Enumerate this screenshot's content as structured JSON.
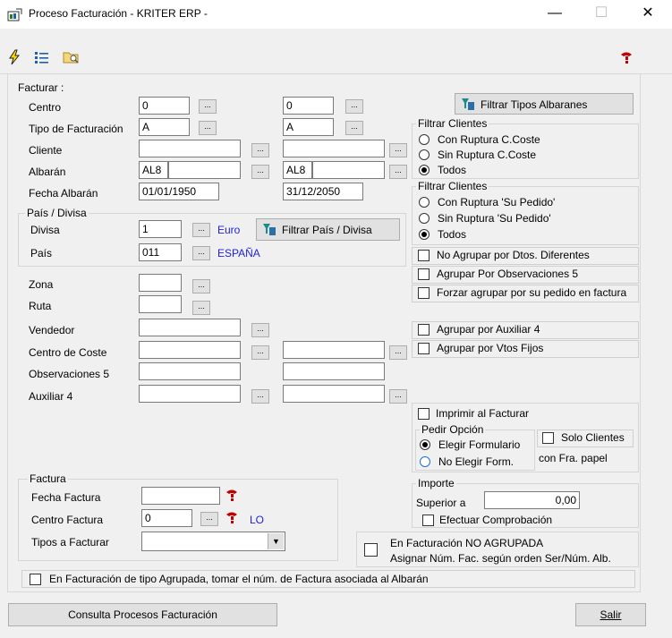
{
  "window": {
    "title": "Proceso Facturación - KRITER ERP -",
    "minimize": "—",
    "maximize": "☐",
    "close": "✕"
  },
  "facturar": {
    "group_label": "Facturar :",
    "centro": {
      "label": "Centro",
      "from": "0",
      "to": "0"
    },
    "tipo": {
      "label": "Tipo de Facturación",
      "from": "A",
      "to": "A"
    },
    "cliente": {
      "label": "Cliente",
      "from": "",
      "to": ""
    },
    "albaran": {
      "label": "Albarán",
      "from_serie": "AL8",
      "from_num": "",
      "to_serie": "AL8",
      "to_num": ""
    },
    "fecha_albaran": {
      "label": "Fecha Albarán",
      "from": "01/01/1950",
      "to": "31/12/2050"
    },
    "dots": "..."
  },
  "pais_divisa": {
    "group_label": "País / Divisa",
    "divisa": {
      "label": "Divisa",
      "value": "1",
      "name": "Euro"
    },
    "pais": {
      "label": "País",
      "value": "011",
      "name": "ESPAÑA"
    },
    "filter_button": "Filtrar País / Divisa"
  },
  "others": {
    "zona": {
      "label": "Zona",
      "value": ""
    },
    "ruta": {
      "label": "Ruta",
      "value": ""
    },
    "vendedor": {
      "label": "Vendedor",
      "value": ""
    },
    "centro_coste": {
      "label": "Centro de Coste",
      "from": "",
      "to": ""
    },
    "obs5": {
      "label": "Observaciones 5",
      "from": "",
      "to": ""
    },
    "aux4": {
      "label": "Auxiliar 4",
      "from": "",
      "to": ""
    }
  },
  "right": {
    "filtrar_tipos_button": "Filtrar Tipos Albaranes",
    "filtrar_clientes_1": {
      "title": "Filtrar Clientes",
      "options": [
        "Con Ruptura C.Coste",
        "Sin Ruptura C.Coste",
        "Todos"
      ],
      "selected": 2
    },
    "filtrar_clientes_2": {
      "title": "Filtrar Clientes",
      "options": [
        "Con Ruptura 'Su Pedido'",
        "Sin Ruptura 'Su Pedido'",
        "Todos"
      ],
      "selected": 2
    },
    "checks": {
      "no_agrupar": "No Agrupar por Dtos. Diferentes",
      "agrupar_obs5": "Agrupar Por Observaciones 5",
      "forzar": "Forzar agrupar por su pedido en factura",
      "agrupar_aux4": "Agrupar por Auxiliar 4",
      "agrupar_vtos": "Agrupar por Vtos Fijos",
      "imprimir": "Imprimir al Facturar"
    },
    "pedir_opcion": {
      "title": "Pedir Opción",
      "options": [
        "Elegir Formulario",
        "No Elegir Form."
      ],
      "selected": 0
    },
    "solo_clientes": "Solo Clientes",
    "con_fra_papel": "con Fra. papel",
    "importe": {
      "title": "Importe",
      "superior_label": "Superior a",
      "superior_value": "0,00",
      "efectuar": "Efectuar Comprobación"
    },
    "no_agrupada": {
      "line1": "En Facturación NO AGRUPADA",
      "line2": "Asignar Núm. Fac. según orden Ser/Núm. Alb."
    }
  },
  "factura": {
    "group_label": "Factura",
    "fecha": {
      "label": "Fecha Factura",
      "value": ""
    },
    "centro": {
      "label": "Centro Factura",
      "value": "0",
      "code": "LO"
    },
    "tipos": {
      "label": "Tipos a Facturar",
      "value": ""
    }
  },
  "agrupada_check": "En Facturación de tipo Agrupada, tomar el núm. de Factura asociada al Albarán",
  "footer": {
    "consulta_button": "Consulta Procesos Facturación",
    "salir_button": "Salir"
  },
  "colors": {
    "link_blue": "#1f1fd6",
    "accent": "#1f6fd6",
    "icon_red": "#c00000"
  }
}
